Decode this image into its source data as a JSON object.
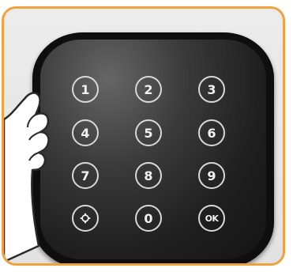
{
  "accent_color": "#f0a23e",
  "panel_color": "#141414",
  "keypad": {
    "keys": [
      {
        "label": "1",
        "icon": null
      },
      {
        "label": "2",
        "icon": null
      },
      {
        "label": "3",
        "icon": null
      },
      {
        "label": "4",
        "icon": null
      },
      {
        "label": "5",
        "icon": null
      },
      {
        "label": "6",
        "icon": null
      },
      {
        "label": "7",
        "icon": null
      },
      {
        "label": "8",
        "icon": null
      },
      {
        "label": "9",
        "icon": null
      },
      {
        "label": "",
        "icon": "gear-icon"
      },
      {
        "label": "0",
        "icon": null
      },
      {
        "label": "OK",
        "icon": null
      }
    ]
  },
  "hand": {
    "icon": "pointing-finger-icon"
  }
}
